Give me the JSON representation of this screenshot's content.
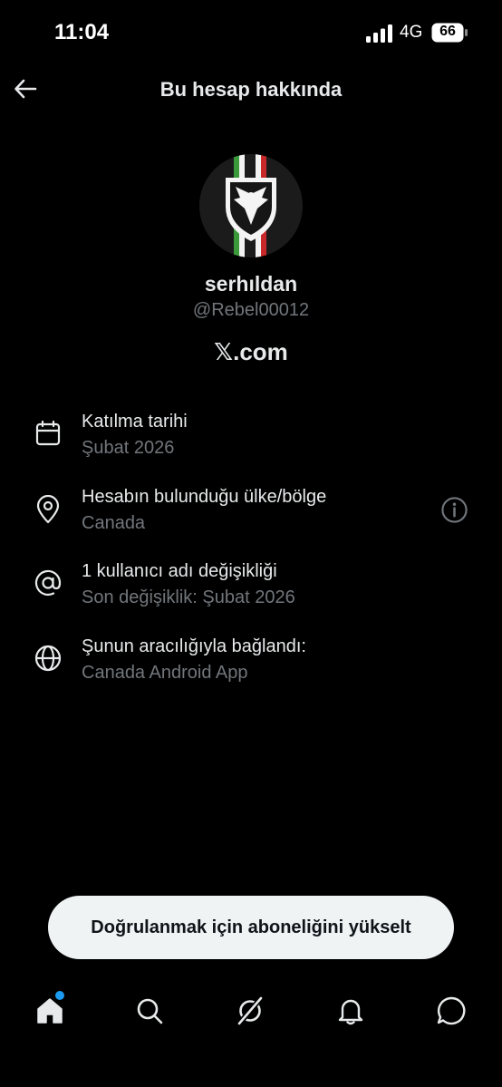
{
  "status_bar": {
    "time": "11:04",
    "network": "4G",
    "battery": "66"
  },
  "header": {
    "title": "Bu hesap hakkında"
  },
  "profile": {
    "display_name": "serhıldan",
    "handle": "@Rebel00012",
    "site": "𝕏.com"
  },
  "info_rows": [
    {
      "icon": "calendar-icon",
      "label": "Katılma tarihi",
      "value": "Şubat 2026"
    },
    {
      "icon": "location-pin-icon",
      "label": "Hesabın bulunduğu ülke/bölge",
      "value": "Canada"
    },
    {
      "icon": "at-sign-icon",
      "label": "1 kullanıcı adı değişikliği",
      "value": "Son değişiklik: Şubat 2026"
    },
    {
      "icon": "globe-icon",
      "label": "Şunun aracılığıyla bağlandı:",
      "value": "Canada Android App"
    }
  ],
  "upgrade_button": {
    "label": "Doğrulanmak için aboneliğini yükselt"
  },
  "bottom_nav": [
    "home-icon",
    "search-icon",
    "grok-icon",
    "notifications-icon",
    "messages-icon"
  ],
  "colors": {
    "background": "#000000",
    "primary_text": "#e7e9ea",
    "secondary_text": "#71767b",
    "accent": "#1d9bf0",
    "button_bg": "#eff3f4"
  }
}
